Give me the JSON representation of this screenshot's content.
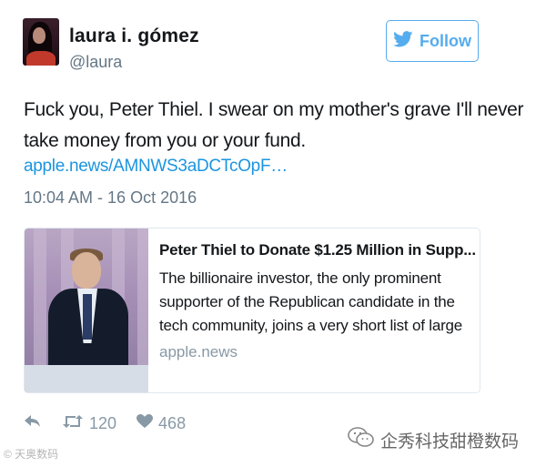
{
  "tweet": {
    "author": {
      "name": "laura i. gómez",
      "handle": "@laura"
    },
    "follow_label": "Follow",
    "text_line1": "Fuck you, Peter Thiel. I swear on my mother's grave I'll never",
    "text_line2": "take money from you or your fund.",
    "link": "apple.news/AMNWS3aDCTcOpF…",
    "timestamp": "10:04 AM - 16 Oct 2016",
    "card": {
      "title": "Peter Thiel to Donate $1.25 Million in Supp...",
      "desc_line1": "The billionaire investor, the only prominent",
      "desc_line2": "supporter of the Republican candidate in the",
      "desc_line3": "tech community, joins a very short list of large",
      "domain": "apple.news"
    },
    "actions": {
      "retweet_count": "120",
      "like_count": "468"
    }
  },
  "watermarks": {
    "left": "© 天奥数码",
    "right": "企秀科技甜橙数码"
  },
  "colors": {
    "brand_blue": "#55acee",
    "link_blue": "#1b95e0",
    "muted_gray": "#657786"
  },
  "icons": [
    "twitter-bird-icon",
    "reply-icon",
    "retweet-icon",
    "heart-icon",
    "wechat-icon"
  ]
}
